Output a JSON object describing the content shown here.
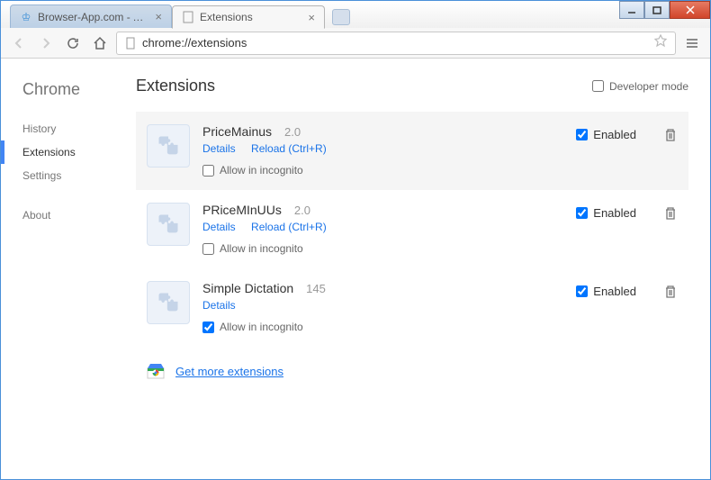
{
  "tabs": [
    {
      "title": "Browser-App.com - A free...",
      "active": false
    },
    {
      "title": "Extensions",
      "active": true
    }
  ],
  "omnibox": {
    "url": "chrome://extensions"
  },
  "sidebar": {
    "title": "Chrome",
    "items": [
      "History",
      "Extensions",
      "Settings"
    ],
    "about": "About"
  },
  "main": {
    "title": "Extensions",
    "dev_mode_label": "Developer mode"
  },
  "extensions": [
    {
      "name": "PriceMainus",
      "version": "2.0",
      "details": "Details",
      "reload": "Reload (Ctrl+R)",
      "incognito_label": "Allow in incognito",
      "incognito_checked": false,
      "enabled_label": "Enabled",
      "enabled_checked": true,
      "highlighted": true,
      "show_reload": true
    },
    {
      "name": "PRiceMInUUs",
      "version": "2.0",
      "details": "Details",
      "reload": "Reload (Ctrl+R)",
      "incognito_label": "Allow in incognito",
      "incognito_checked": false,
      "enabled_label": "Enabled",
      "enabled_checked": true,
      "highlighted": false,
      "show_reload": true
    },
    {
      "name": "Simple Dictation",
      "version": "145",
      "details": "Details",
      "reload": "",
      "incognito_label": "Allow in incognito",
      "incognito_checked": true,
      "enabled_label": "Enabled",
      "enabled_checked": true,
      "highlighted": false,
      "show_reload": false
    }
  ],
  "more_extensions": "Get more extensions"
}
